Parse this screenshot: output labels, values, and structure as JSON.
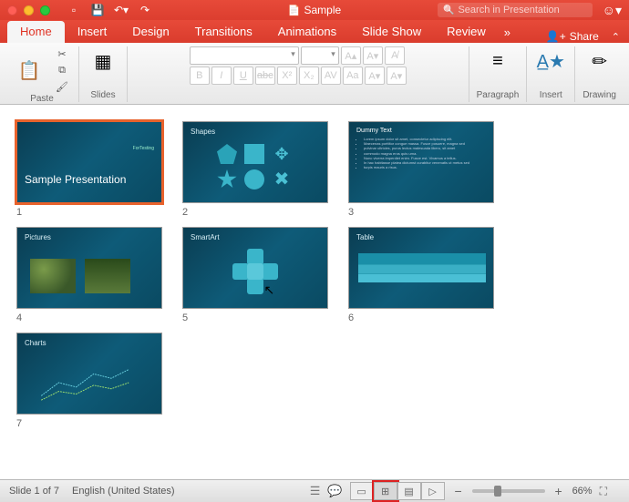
{
  "titlebar": {
    "doc_name": "Sample",
    "search_placeholder": "Search in Presentation"
  },
  "tabs": {
    "items": [
      "Home",
      "Insert",
      "Design",
      "Transitions",
      "Animations",
      "Slide Show",
      "Review"
    ],
    "active_index": 0,
    "more": "»",
    "share": "Share",
    "collapse": "⌃"
  },
  "ribbon": {
    "paste": "Paste",
    "slides": "Slides",
    "font_name_placeholder": "",
    "font_size_placeholder": "",
    "bold": "B",
    "italic": "I",
    "underline": "U",
    "strike": "abc",
    "super": "X²",
    "sub": "X₂",
    "spacing": "AV",
    "clear": "Aₐ",
    "case": "Aa",
    "grow": "A▴",
    "shrink": "A▾",
    "paragraph": "Paragraph",
    "insert": "Insert",
    "drawing": "Drawing"
  },
  "slides": [
    {
      "num": "1",
      "title": "",
      "big": "Sample Presentation",
      "sub": "ForTesting",
      "kind": "title",
      "selected": true
    },
    {
      "num": "2",
      "title": "Shapes",
      "kind": "shapes"
    },
    {
      "num": "3",
      "title": "Dummy Text",
      "kind": "text",
      "bullets": [
        "Lorem ipsum dolor sit amet, consectetur adipiscing elit.",
        "Maecenas porttitor congue massa. Fusce posuere, magna sed",
        "pulvinar ultricies, purus lectus malesuada libero, sit amet",
        "commodo magna eros quis urna.",
        "Nunc viverra imperdiet enim. Fusce est. Vivamus a tellus.",
        "In hac habitasse platea dictumst curabitur venenatis ut metus sed",
        "turpis mauris a risus."
      ]
    },
    {
      "num": "4",
      "title": "Pictures",
      "kind": "pics"
    },
    {
      "num": "5",
      "title": "SmartArt",
      "kind": "smart"
    },
    {
      "num": "6",
      "title": "Table",
      "kind": "table"
    },
    {
      "num": "7",
      "title": "Charts",
      "kind": "chart"
    }
  ],
  "statusbar": {
    "slide_info": "Slide 1 of 7",
    "language": "English (United States)",
    "zoom": "66%"
  },
  "icons": {
    "scissors": "✂",
    "copy": "⧉",
    "brush": "🖌",
    "star": "✦",
    "user": "👤",
    "notes": "☰",
    "comments": "💬",
    "normal": "▭",
    "sorter": "⊞",
    "reading": "▤",
    "play": "▷",
    "fit": "⛶",
    "minus": "−",
    "plus": "+"
  },
  "colors": {
    "brand": "#e03324",
    "select": "#e8622c",
    "slidebg": "#0c5470"
  }
}
